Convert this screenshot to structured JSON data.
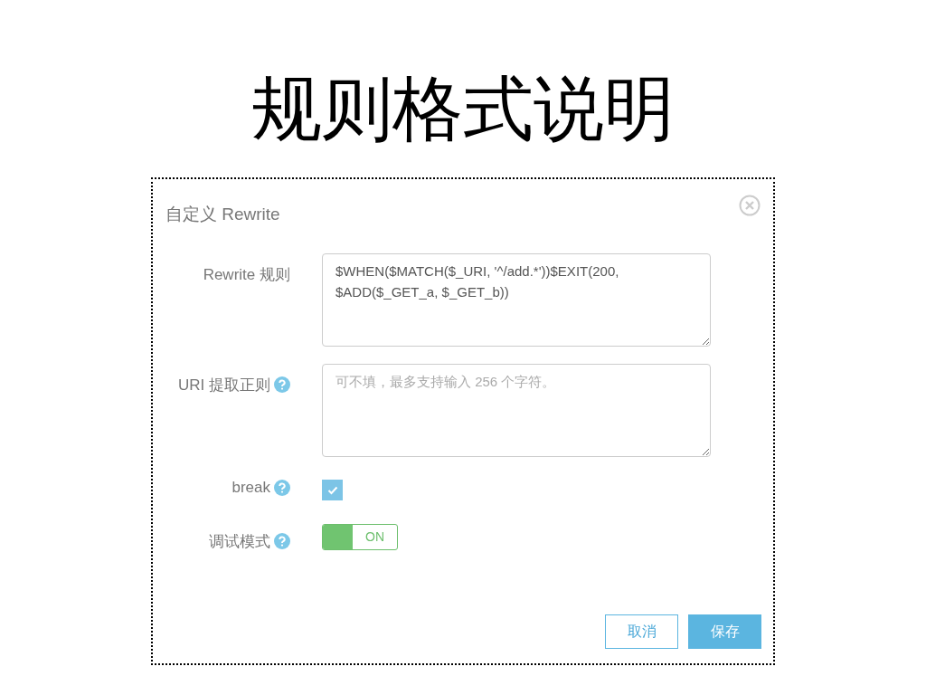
{
  "slide_title": "规则格式说明",
  "dialog": {
    "title": "自定义 Rewrite",
    "fields": [
      {
        "kind": "textarea",
        "label": "Rewrite 规则",
        "help": false,
        "value": "$WHEN($MATCH($_URI, '^/add.*'))$EXIT(200, $ADD($_GET_a, $_GET_b))"
      },
      {
        "kind": "textarea",
        "label": "URI 提取正则",
        "help": true,
        "placeholder": "可不填，最多支持输入 256 个字符。"
      },
      {
        "kind": "checkbox",
        "label": "break",
        "help": true,
        "checked": true
      },
      {
        "kind": "toggle",
        "label": "调试模式",
        "help": true,
        "on": true,
        "state_text": "ON"
      }
    ],
    "buttons": [
      {
        "kind": "secondary",
        "label": "取消"
      },
      {
        "kind": "primary",
        "label": "保存"
      }
    ]
  }
}
